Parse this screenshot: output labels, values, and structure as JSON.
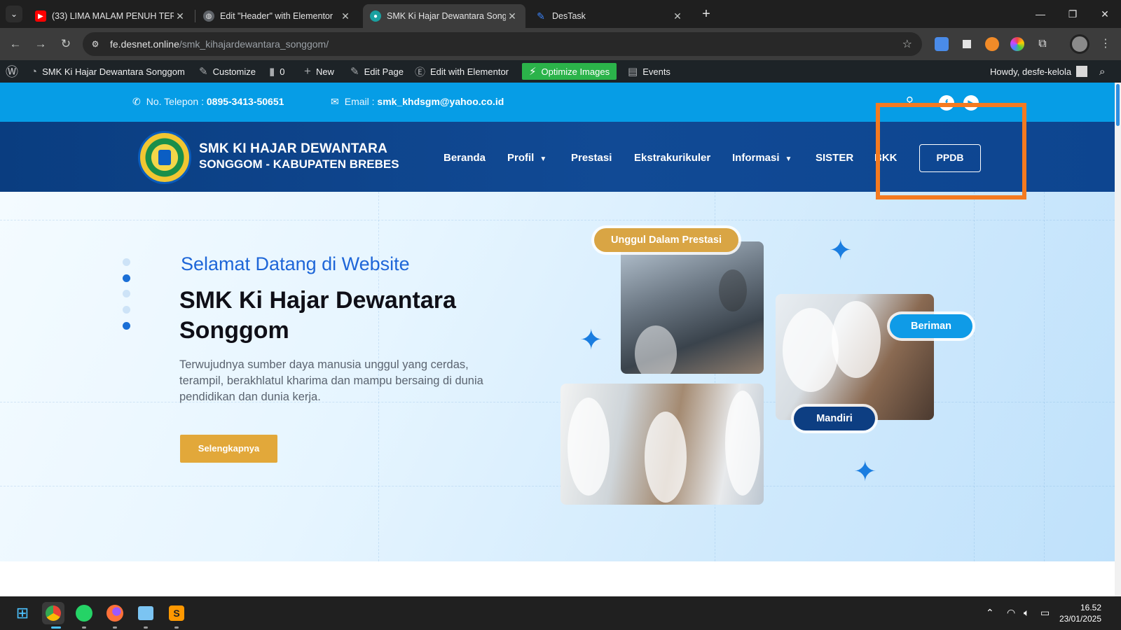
{
  "browser": {
    "tabs": [
      {
        "title": "(33) LIMA MALAM PENUH TER",
        "icon": "youtube-icon",
        "active": false
      },
      {
        "title": "Edit \"Header\" with Elementor",
        "icon": "globe-icon",
        "active": false
      },
      {
        "title": "SMK Ki Hajar Dewantara Songg",
        "icon": "site-icon",
        "active": true
      },
      {
        "title": "DesTask",
        "icon": "destask-icon",
        "active": false
      }
    ],
    "url_host": "fe.desnet.online",
    "url_path": "/smk_kihajardewantara_songgom/"
  },
  "adminbar": {
    "site_name": "SMK Ki Hajar Dewantara Songgom",
    "customize": "Customize",
    "comments_count": "0",
    "new": "New",
    "edit_page": "Edit Page",
    "edit_elementor": "Edit with Elementor",
    "optimize": "Optimize Images",
    "events": "Events",
    "howdy": "Howdy, desfe-kelola"
  },
  "topbar": {
    "phone_label": "No. Telepon :",
    "phone": "0895-3413-50651",
    "email_label": "Email :",
    "email": "smk_khdsgm@yahoo.co.id"
  },
  "header": {
    "brand_line1": "SMK KI HAJAR DEWANTARA",
    "brand_line2": "SONGGOM - KABUPATEN BREBES",
    "nav": [
      {
        "label": "Beranda"
      },
      {
        "label": "Profil"
      },
      {
        "label": "Prestasi"
      },
      {
        "label": "Ekstrakurikuler"
      },
      {
        "label": "Informasi"
      },
      {
        "label": "SISTER"
      },
      {
        "label": "BKK"
      }
    ],
    "cta": "PPDB"
  },
  "hero": {
    "welcome": "Selamat Datang di Website",
    "title": "SMK Ki Hajar Dewantara Songgom",
    "description": "Terwujudnya sumber daya manusia unggul yang cerdas, terampil, berakhlatul kharima dan mampu bersaing di dunia pendidikan dan dunia kerja.",
    "button": "Selengkapnya",
    "badges": {
      "prestasi": "Unggul Dalam Prestasi",
      "beriman": "Beriman",
      "mandiri": "Mandiri"
    },
    "active_slide": 2,
    "slide_count": 5
  },
  "taskbar": {
    "time": "16.52",
    "date": "23/01/2025"
  },
  "colors": {
    "topbar": "#069de6",
    "nav": "#0a3d80",
    "accent_gold": "#e2a83a",
    "highlight": "#f47a20"
  }
}
